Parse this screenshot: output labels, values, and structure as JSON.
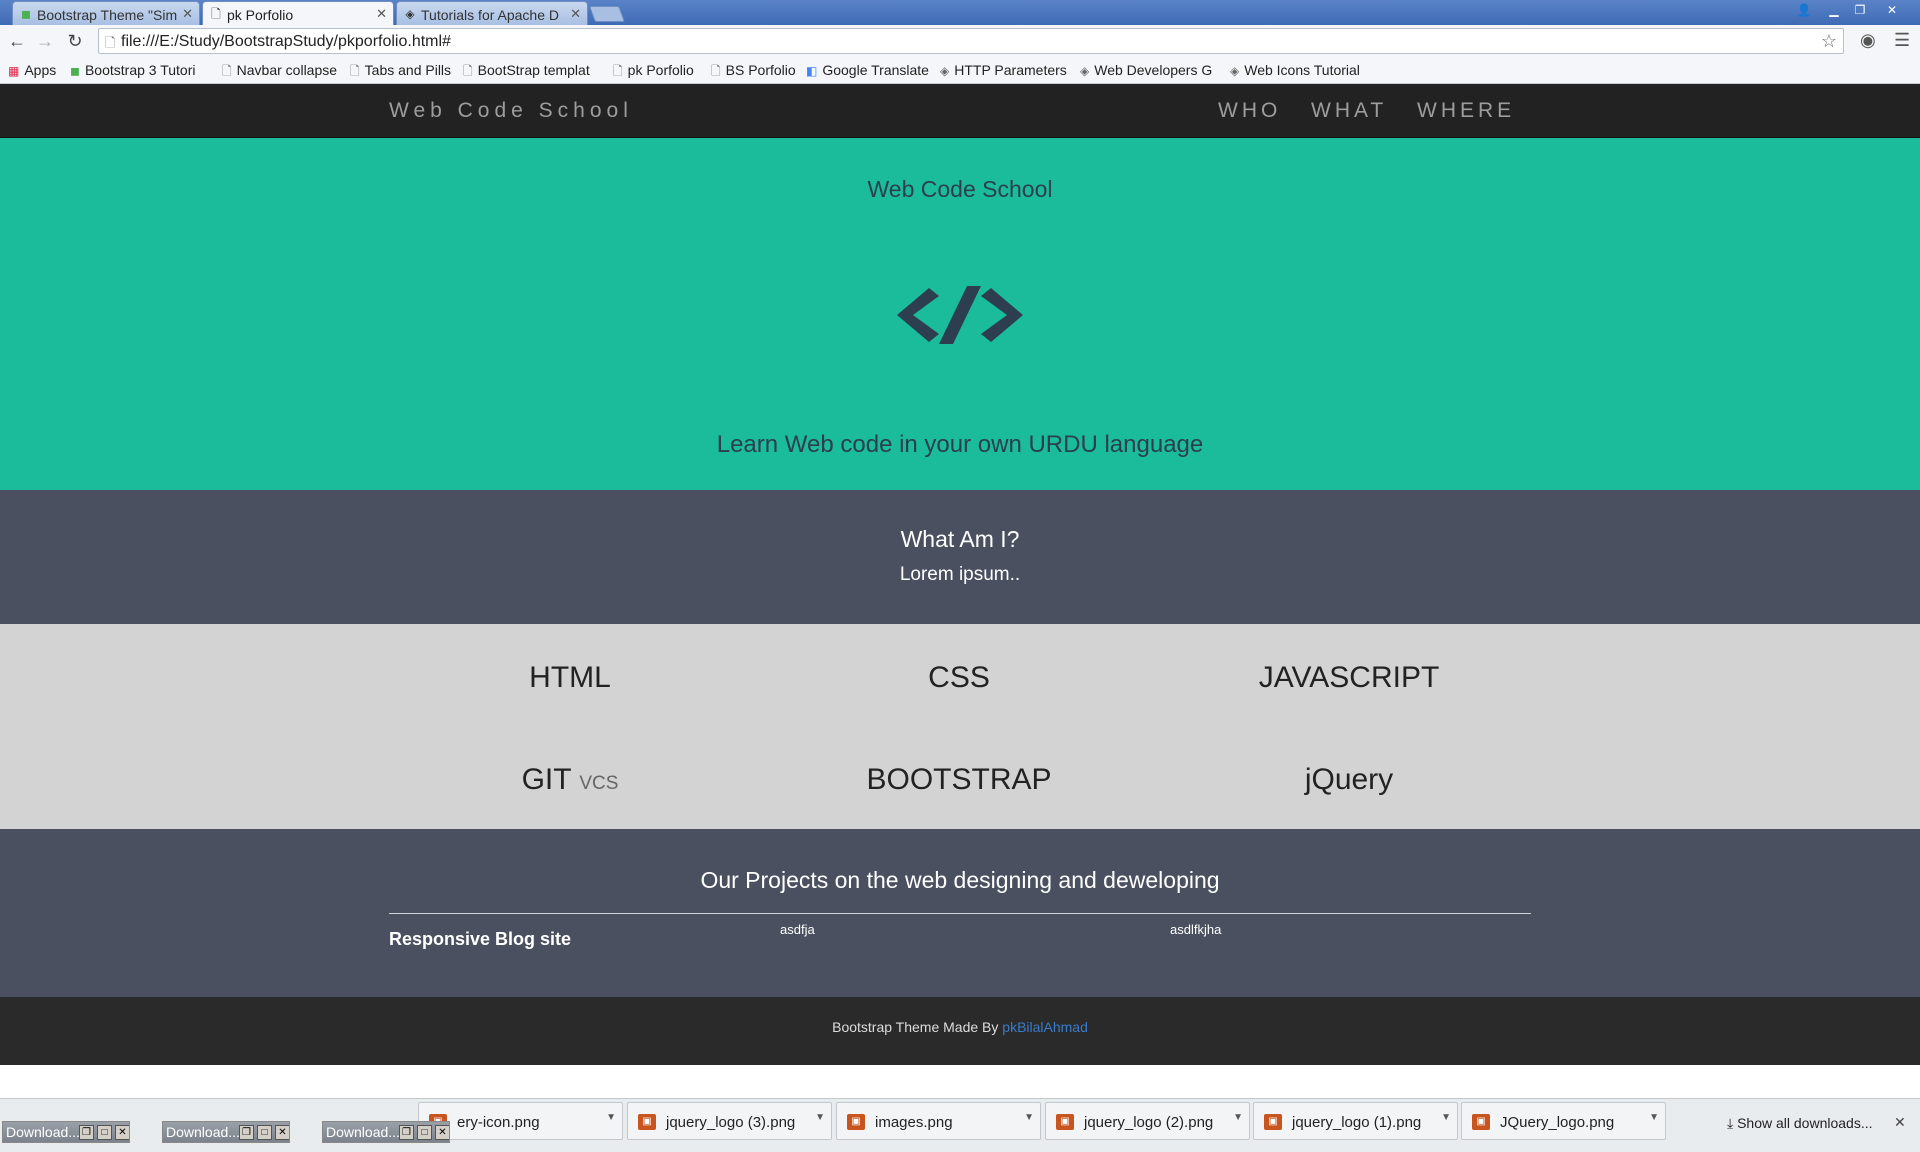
{
  "browser": {
    "tabs": [
      {
        "title": "Bootstrap Theme \"Sim",
        "active": false
      },
      {
        "title": "pk Porfolio",
        "active": true
      },
      {
        "title": "Tutorials for Apache D",
        "active": false
      }
    ],
    "url": "file:///E:/Study/BootstrapStudy/pkporfolio.html#",
    "bookmarks": [
      {
        "label": "Apps",
        "icon": "apps-grid-icon"
      },
      {
        "label": "Bootstrap 3 Tutori",
        "icon": "w3-icon"
      },
      {
        "label": "Navbar collapse",
        "icon": "page-icon"
      },
      {
        "label": "Tabs and Pills",
        "icon": "page-icon"
      },
      {
        "label": "BootStrap templat",
        "icon": "page-icon"
      },
      {
        "label": "pk Porfolio",
        "icon": "page-icon"
      },
      {
        "label": "BS Porfolio",
        "icon": "page-icon"
      },
      {
        "label": "Google Translate",
        "icon": "translate-icon"
      },
      {
        "label": "HTTP Parameters",
        "icon": "diamond-icon"
      },
      {
        "label": "Web Developers G",
        "icon": "diamond-icon"
      },
      {
        "label": "Web Icons Tutorial",
        "icon": "diamond-icon"
      }
    ]
  },
  "site": {
    "brand": "Web Code School",
    "nav": [
      "WHO",
      "WHAT",
      "WHERE"
    ],
    "hero": {
      "title": "Web Code School",
      "icon": "code-brackets-icon",
      "tagline": "Learn Web code in your own URDU language"
    },
    "about": {
      "title": "What Am I?",
      "text": "Lorem ipsum.."
    },
    "skills": {
      "html": "HTML",
      "css": "CSS",
      "javascript": "JAVASCRIPT",
      "git": "GIT",
      "git_sub": "VCS",
      "bootstrap": "BOOTSTRAP",
      "jquery": "jQuery"
    },
    "projects": {
      "title": "Our Projects on the web designing and deweloping",
      "items": [
        "Responsive Blog site",
        "asdfja",
        "asdlfkjha"
      ]
    },
    "footer": {
      "text": "Bootstrap Theme Made By ",
      "link": "pkBilalAhmad"
    }
  },
  "downloads": {
    "items": [
      "ery-icon.png",
      "jquery_logo (3).png",
      "images.png",
      "jquery_logo (2).png",
      "jquery_logo (1).png",
      "JQuery_logo.png"
    ],
    "show_all": "Show all downloads...",
    "minimized_windows": [
      "Download...",
      "Download...",
      "Download..."
    ]
  },
  "colors": {
    "hero_bg": "#1abc9c",
    "dark_section_bg": "#4a505f",
    "skills_bg": "#d3d3d3",
    "navbar_bg": "#222222",
    "footer_bg": "#2a2a2a",
    "link": "#3a7bc8"
  }
}
